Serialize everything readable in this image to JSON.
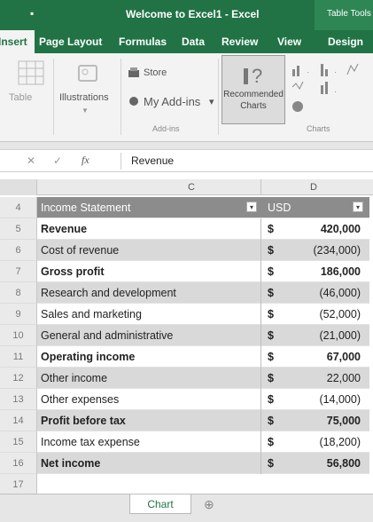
{
  "window": {
    "title": "Welcome to Excel1 - Excel",
    "context_tab": "Table Tools",
    "qat_symbol": "▪"
  },
  "ribbon_tabs": [
    "Insert",
    "Page Layout",
    "Formulas",
    "Data",
    "Review",
    "View",
    "Design"
  ],
  "ribbon": {
    "table_label": "Table",
    "illustrations_label": "Illustrations",
    "store_label": "Store",
    "my_addins_label": "My Add-ins",
    "addins_group": "Add-ins",
    "recommended_line1": "Recommended",
    "recommended_line2": "Charts",
    "charts_group": "Charts"
  },
  "formula_bar": {
    "cancel": "✕",
    "enter": "✓",
    "fx": "fx",
    "content": "Revenue"
  },
  "columns": {
    "c": "C",
    "d": "D"
  },
  "table": {
    "header_label": "Income Statement",
    "header_currency": "USD",
    "rows": [
      {
        "num": "5",
        "label": "Revenue",
        "cur": "$",
        "value": "420,000",
        "bold": true,
        "style": "white"
      },
      {
        "num": "6",
        "label": "Cost of revenue",
        "cur": "$",
        "value": "(234,000)",
        "bold": false,
        "style": "band"
      },
      {
        "num": "7",
        "label": "Gross profit",
        "cur": "$",
        "value": "186,000",
        "bold": true,
        "style": "white"
      },
      {
        "num": "8",
        "label": "Research and development",
        "cur": "$",
        "value": "(46,000)",
        "bold": false,
        "style": "band"
      },
      {
        "num": "9",
        "label": "Sales and marketing",
        "cur": "$",
        "value": "(52,000)",
        "bold": false,
        "style": "white"
      },
      {
        "num": "10",
        "label": "General and administrative",
        "cur": "$",
        "value": "(21,000)",
        "bold": false,
        "style": "band"
      },
      {
        "num": "11",
        "label": "Operating income",
        "cur": "$",
        "value": "67,000",
        "bold": true,
        "style": "white"
      },
      {
        "num": "12",
        "label": "Other income",
        "cur": "$",
        "value": "22,000",
        "bold": false,
        "style": "band"
      },
      {
        "num": "13",
        "label": "Other expenses",
        "cur": "$",
        "value": "(14,000)",
        "bold": false,
        "style": "white"
      },
      {
        "num": "14",
        "label": "Profit before tax",
        "cur": "$",
        "value": "75,000",
        "bold": true,
        "style": "band"
      },
      {
        "num": "15",
        "label": "Income tax expense",
        "cur": "$",
        "value": "(18,200)",
        "bold": false,
        "style": "white"
      },
      {
        "num": "16",
        "label": "Net income",
        "cur": "$",
        "value": "56,800",
        "bold": true,
        "style": "band"
      }
    ],
    "header_row_num": "4",
    "empty_row_num": "17"
  },
  "sheet_tabs": [
    "Chart"
  ],
  "colors": {
    "excel_green": "#217346",
    "header_gray": "#8c8c8c",
    "band_gray": "#d9d9d9"
  }
}
